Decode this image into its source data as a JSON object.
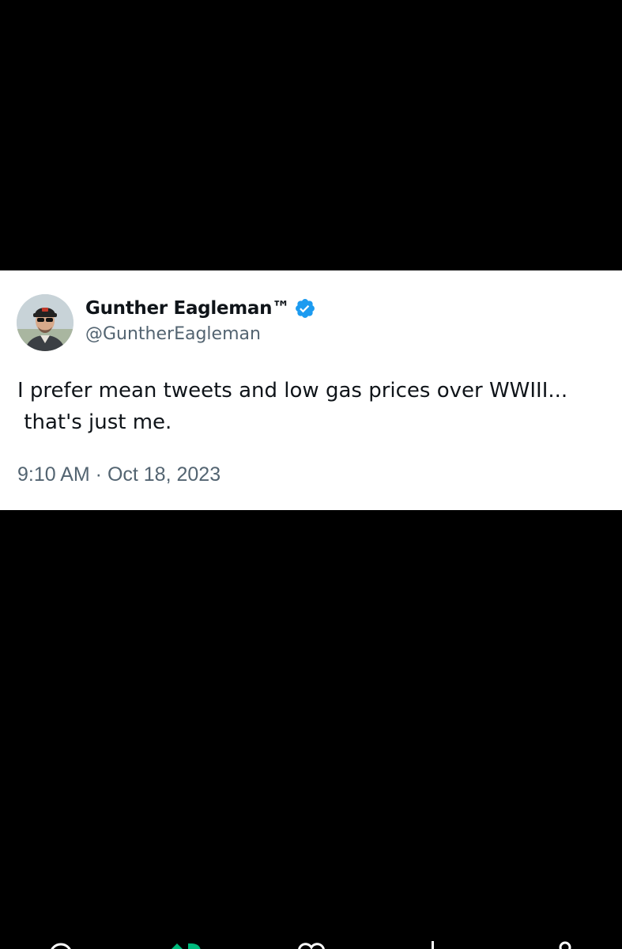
{
  "tweet": {
    "display_name": "Gunther Eagleman™",
    "handle": "@GuntherEagleman",
    "text": "I prefer mean tweets and low gas prices over WWIII...\n that's just me.",
    "timestamp": "9:10 AM · Oct 18, 2023",
    "verified": true,
    "verified_color": "#1d9bf0"
  },
  "bottom_nav": {
    "icons": [
      "search-icon",
      "grok-icon",
      "heart-icon",
      "download-icon",
      "profile-icon"
    ],
    "accent_color": "#00ba7c"
  }
}
